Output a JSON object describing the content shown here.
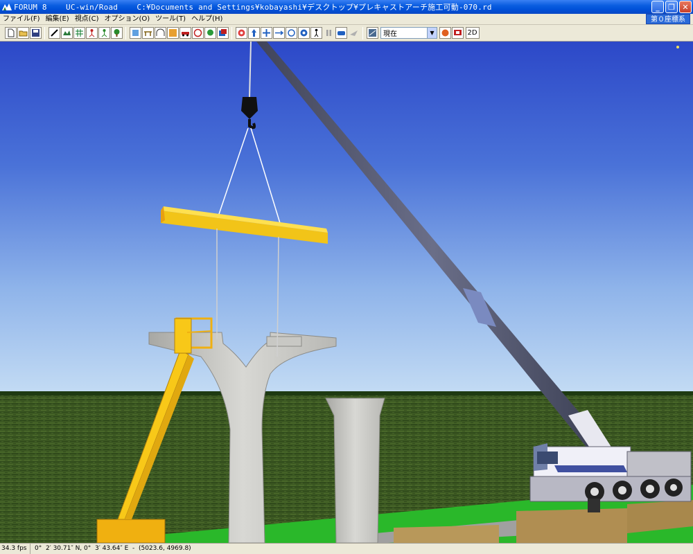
{
  "window": {
    "title": "FORUM 8    UC-win/Road    C:¥Documents and Settings¥kobayashi¥デスクトップ¥プレキャストアーチ施工可動-070.rd",
    "minimize_label": "_",
    "restore_label": "❐",
    "close_label": "✕"
  },
  "menu": {
    "items": [
      "ファイル(F)",
      "編集(E)",
      "視点(C)",
      "オプション(O)",
      "ツール(T)",
      "ヘルプ(H)"
    ],
    "coord_system": "第０座標系"
  },
  "toolbar": {
    "time_select_value": "現在",
    "toggle_2d_label": "2D"
  },
  "status": {
    "fps": "34.3 fps",
    "coordinates": "0°  2′ 30.71″ N, 0°  3′ 43.64″ E  -  (5023.6, 4969.8)"
  },
  "colors": {
    "sky_top": "#2c48c8",
    "sky_bottom": "#b4d2f0",
    "grass": "#3c5a22",
    "beam": "#f2c418",
    "crane_boom": "#5a5e78"
  },
  "icons": {
    "toolbar_group1": [
      "new-file-icon",
      "open-folder-icon",
      "save-icon"
    ],
    "toolbar_group2": [
      "road-edit-icon",
      "terrain-icon",
      "grid-icon",
      "person-icon",
      "person-walk-icon",
      "tree-icon"
    ],
    "toolbar_group3": [
      "import-icon",
      "bridge-icon",
      "tunnel-icon",
      "texture-icon",
      "car-icon",
      "sign-icon",
      "plant-icon",
      "layer-icon"
    ],
    "toolbar_group4": [
      "target-icon",
      "up-arrow-icon",
      "pan-icon",
      "move-icon",
      "rotate-icon",
      "zoom-icon",
      "walk-icon",
      "pause-icon",
      "drive-icon",
      "fly-icon"
    ]
  }
}
